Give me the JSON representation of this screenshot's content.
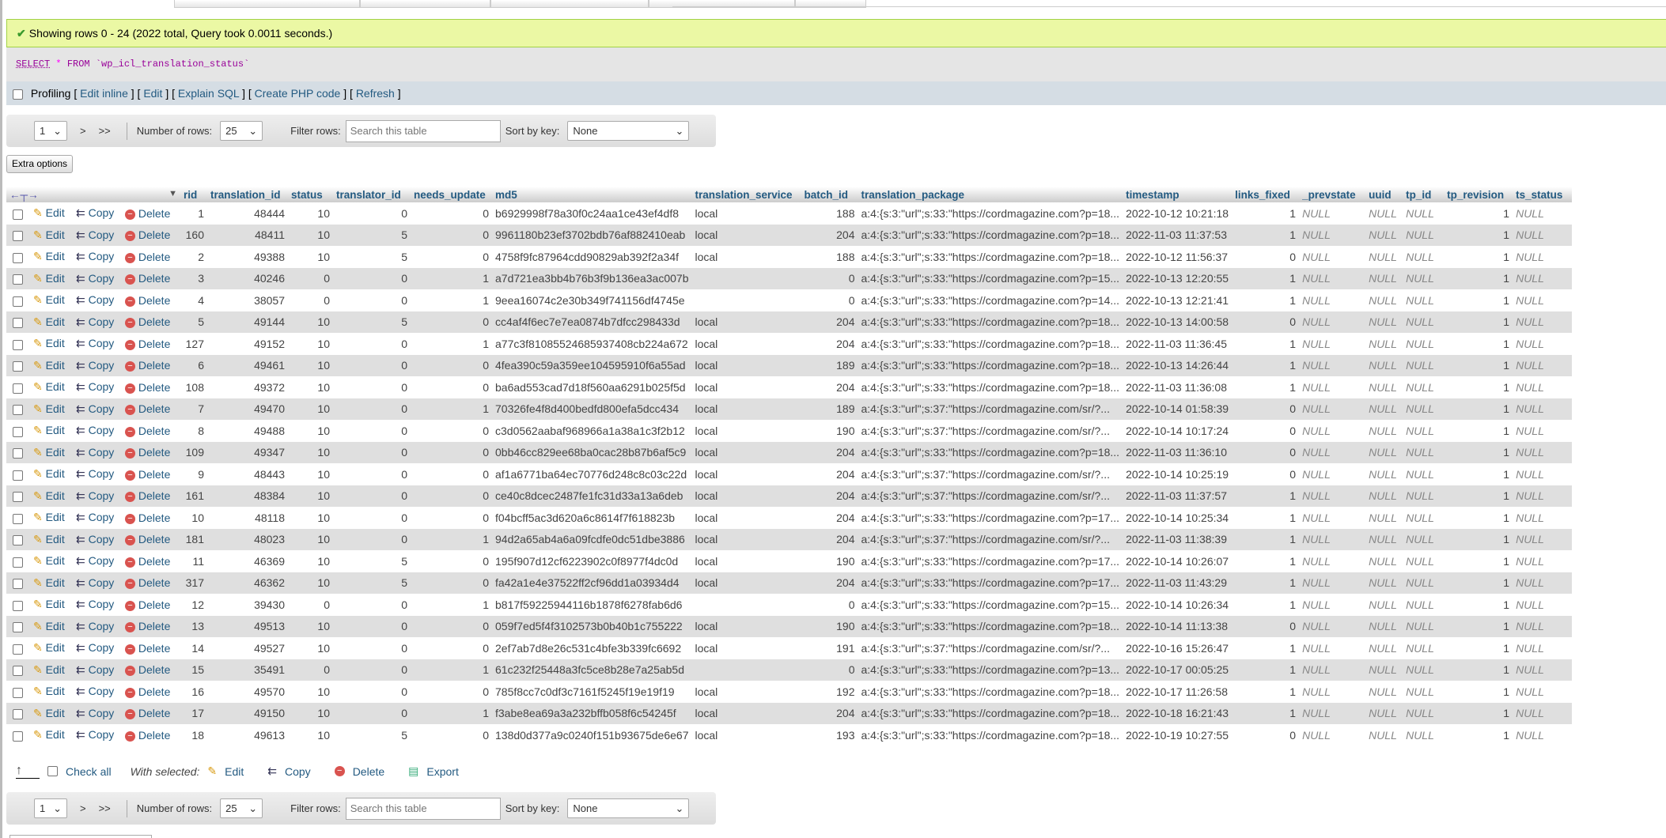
{
  "message": "Showing rows 0 - 24 (2022 total, Query took 0.0011 seconds.)",
  "sql": {
    "keyword": "SELECT",
    "star": "*",
    "from": "FROM",
    "table": "`wp_icl_translation_status`"
  },
  "profiling": {
    "label": "Profiling",
    "links": [
      "Edit inline",
      "Edit",
      "Explain SQL",
      "Create PHP code",
      "Refresh"
    ]
  },
  "nav": {
    "page": "1",
    "next": ">",
    "last": ">>",
    "rows_label": "Number of rows:",
    "rows_value": "25",
    "filter_label": "Filter rows:",
    "filter_placeholder": "Search this table",
    "sort_label": "Sort by key:",
    "sort_value": "None"
  },
  "extra_options": "Extra options",
  "actions": {
    "edit": "Edit",
    "copy": "Copy",
    "delete": "Delete"
  },
  "columns": [
    "rid",
    "translation_id",
    "status",
    "translator_id",
    "needs_update",
    "md5",
    "translation_service",
    "batch_id",
    "translation_package",
    "timestamp",
    "links_fixed",
    "_prevstate",
    "uuid",
    "tp_id",
    "tp_revision",
    "ts_status"
  ],
  "rows": [
    {
      "rid": "1",
      "translation_id": "48444",
      "status": "10",
      "translator_id": "0",
      "needs_update": "0",
      "md5": "b6929998f78a30f0c24aa1ce43ef4df8",
      "translation_service": "local",
      "batch_id": "188",
      "translation_package": "a:4:{s:3:\"url\";s:33:\"https://cordmagazine.com?p=18...",
      "timestamp": "2022-10-12 10:21:18",
      "links_fixed": "1",
      "_prevstate": "NULL",
      "uuid": "NULL",
      "tp_id": "NULL",
      "tp_revision": "1",
      "ts_status": "NULL"
    },
    {
      "rid": "160",
      "translation_id": "48411",
      "status": "10",
      "translator_id": "5",
      "needs_update": "0",
      "md5": "9961180b23ef3702bdb76af882410eab",
      "translation_service": "local",
      "batch_id": "204",
      "translation_package": "a:4:{s:3:\"url\";s:33:\"https://cordmagazine.com?p=18...",
      "timestamp": "2022-11-03 11:37:53",
      "links_fixed": "1",
      "_prevstate": "NULL",
      "uuid": "NULL",
      "tp_id": "NULL",
      "tp_revision": "1",
      "ts_status": "NULL"
    },
    {
      "rid": "2",
      "translation_id": "49388",
      "status": "10",
      "translator_id": "5",
      "needs_update": "0",
      "md5": "4758f9fc87964cdd90829ab392f2a34f",
      "translation_service": "local",
      "batch_id": "188",
      "translation_package": "a:4:{s:3:\"url\";s:33:\"https://cordmagazine.com?p=18...",
      "timestamp": "2022-10-12 11:56:37",
      "links_fixed": "0",
      "_prevstate": "NULL",
      "uuid": "NULL",
      "tp_id": "NULL",
      "tp_revision": "1",
      "ts_status": "NULL"
    },
    {
      "rid": "3",
      "translation_id": "40246",
      "status": "0",
      "translator_id": "0",
      "needs_update": "1",
      "md5": "a7d721ea3bb4b76b3f9b136ea3ac007b",
      "translation_service": "",
      "batch_id": "0",
      "translation_package": "a:4:{s:3:\"url\";s:33:\"https://cordmagazine.com?p=15...",
      "timestamp": "2022-10-13 12:20:55",
      "links_fixed": "1",
      "_prevstate": "NULL",
      "uuid": "NULL",
      "tp_id": "NULL",
      "tp_revision": "1",
      "ts_status": "NULL"
    },
    {
      "rid": "4",
      "translation_id": "38057",
      "status": "0",
      "translator_id": "0",
      "needs_update": "1",
      "md5": "9eea16074c2e30b349f741156df4745e",
      "translation_service": "",
      "batch_id": "0",
      "translation_package": "a:4:{s:3:\"url\";s:33:\"https://cordmagazine.com?p=14...",
      "timestamp": "2022-10-13 12:21:41",
      "links_fixed": "1",
      "_prevstate": "NULL",
      "uuid": "NULL",
      "tp_id": "NULL",
      "tp_revision": "1",
      "ts_status": "NULL"
    },
    {
      "rid": "5",
      "translation_id": "49144",
      "status": "10",
      "translator_id": "5",
      "needs_update": "0",
      "md5": "cc4af4f6ec7e7ea0874b7dfcc298433d",
      "translation_service": "local",
      "batch_id": "204",
      "translation_package": "a:4:{s:3:\"url\";s:33:\"https://cordmagazine.com?p=18...",
      "timestamp": "2022-10-13 14:00:58",
      "links_fixed": "0",
      "_prevstate": "NULL",
      "uuid": "NULL",
      "tp_id": "NULL",
      "tp_revision": "1",
      "ts_status": "NULL"
    },
    {
      "rid": "127",
      "translation_id": "49152",
      "status": "10",
      "translator_id": "0",
      "needs_update": "1",
      "md5": "a77c3f81085524685937408cb224a672",
      "translation_service": "local",
      "batch_id": "204",
      "translation_package": "a:4:{s:3:\"url\";s:33:\"https://cordmagazine.com?p=18...",
      "timestamp": "2022-11-03 11:36:45",
      "links_fixed": "1",
      "_prevstate": "NULL",
      "uuid": "NULL",
      "tp_id": "NULL",
      "tp_revision": "1",
      "ts_status": "NULL"
    },
    {
      "rid": "6",
      "translation_id": "49461",
      "status": "10",
      "translator_id": "0",
      "needs_update": "0",
      "md5": "4fea390c59a359ee104595910f6a55ad",
      "translation_service": "local",
      "batch_id": "189",
      "translation_package": "a:4:{s:3:\"url\";s:33:\"https://cordmagazine.com?p=18...",
      "timestamp": "2022-10-13 14:26:44",
      "links_fixed": "1",
      "_prevstate": "NULL",
      "uuid": "NULL",
      "tp_id": "NULL",
      "tp_revision": "1",
      "ts_status": "NULL"
    },
    {
      "rid": "108",
      "translation_id": "49372",
      "status": "10",
      "translator_id": "0",
      "needs_update": "0",
      "md5": "ba6ad553cad7d18f560aa6291b025f5d",
      "translation_service": "local",
      "batch_id": "204",
      "translation_package": "a:4:{s:3:\"url\";s:33:\"https://cordmagazine.com?p=18...",
      "timestamp": "2022-11-03 11:36:08",
      "links_fixed": "1",
      "_prevstate": "NULL",
      "uuid": "NULL",
      "tp_id": "NULL",
      "tp_revision": "1",
      "ts_status": "NULL"
    },
    {
      "rid": "7",
      "translation_id": "49470",
      "status": "10",
      "translator_id": "0",
      "needs_update": "1",
      "md5": "70326fe4f8d400bedfd800efa5dcc434",
      "translation_service": "local",
      "batch_id": "189",
      "translation_package": "a:4:{s:3:\"url\";s:37:\"https://cordmagazine.com/sr/?...",
      "timestamp": "2022-10-14 01:58:39",
      "links_fixed": "0",
      "_prevstate": "NULL",
      "uuid": "NULL",
      "tp_id": "NULL",
      "tp_revision": "1",
      "ts_status": "NULL"
    },
    {
      "rid": "8",
      "translation_id": "49488",
      "status": "10",
      "translator_id": "0",
      "needs_update": "0",
      "md5": "c3d0562aabaf968966a1a38a1c3f2b12",
      "translation_service": "local",
      "batch_id": "190",
      "translation_package": "a:4:{s:3:\"url\";s:37:\"https://cordmagazine.com/sr/?...",
      "timestamp": "2022-10-14 10:17:24",
      "links_fixed": "0",
      "_prevstate": "NULL",
      "uuid": "NULL",
      "tp_id": "NULL",
      "tp_revision": "1",
      "ts_status": "NULL"
    },
    {
      "rid": "109",
      "translation_id": "49347",
      "status": "10",
      "translator_id": "0",
      "needs_update": "0",
      "md5": "0bb46cc829ee68ba0cac28b87b6af5c9",
      "translation_service": "local",
      "batch_id": "204",
      "translation_package": "a:4:{s:3:\"url\";s:33:\"https://cordmagazine.com?p=18...",
      "timestamp": "2022-11-03 11:36:10",
      "links_fixed": "0",
      "_prevstate": "NULL",
      "uuid": "NULL",
      "tp_id": "NULL",
      "tp_revision": "1",
      "ts_status": "NULL"
    },
    {
      "rid": "9",
      "translation_id": "48443",
      "status": "10",
      "translator_id": "0",
      "needs_update": "0",
      "md5": "af1a6771ba64ec70776d248c8c03c22d",
      "translation_service": "local",
      "batch_id": "204",
      "translation_package": "a:4:{s:3:\"url\";s:37:\"https://cordmagazine.com/sr/?...",
      "timestamp": "2022-10-14 10:25:19",
      "links_fixed": "0",
      "_prevstate": "NULL",
      "uuid": "NULL",
      "tp_id": "NULL",
      "tp_revision": "1",
      "ts_status": "NULL"
    },
    {
      "rid": "161",
      "translation_id": "48384",
      "status": "10",
      "translator_id": "0",
      "needs_update": "0",
      "md5": "ce40c8dcec2487fe1fc31d33a13a6deb",
      "translation_service": "local",
      "batch_id": "204",
      "translation_package": "a:4:{s:3:\"url\";s:37:\"https://cordmagazine.com/sr/?...",
      "timestamp": "2022-11-03 11:37:57",
      "links_fixed": "1",
      "_prevstate": "NULL",
      "uuid": "NULL",
      "tp_id": "NULL",
      "tp_revision": "1",
      "ts_status": "NULL"
    },
    {
      "rid": "10",
      "translation_id": "48118",
      "status": "10",
      "translator_id": "0",
      "needs_update": "0",
      "md5": "f04bcff5ac3d620a6c8614f7f618823b",
      "translation_service": "local",
      "batch_id": "204",
      "translation_package": "a:4:{s:3:\"url\";s:33:\"https://cordmagazine.com?p=17...",
      "timestamp": "2022-10-14 10:25:34",
      "links_fixed": "1",
      "_prevstate": "NULL",
      "uuid": "NULL",
      "tp_id": "NULL",
      "tp_revision": "1",
      "ts_status": "NULL"
    },
    {
      "rid": "181",
      "translation_id": "48023",
      "status": "10",
      "translator_id": "0",
      "needs_update": "1",
      "md5": "94d2a65ab4a6a09fcdfe0dc51dbe3886",
      "translation_service": "local",
      "batch_id": "204",
      "translation_package": "a:4:{s:3:\"url\";s:37:\"https://cordmagazine.com/sr/?...",
      "timestamp": "2022-11-03 11:38:39",
      "links_fixed": "1",
      "_prevstate": "NULL",
      "uuid": "NULL",
      "tp_id": "NULL",
      "tp_revision": "1",
      "ts_status": "NULL"
    },
    {
      "rid": "11",
      "translation_id": "46369",
      "status": "10",
      "translator_id": "5",
      "needs_update": "0",
      "md5": "195f907d12cf6223902c0f8977f4dc0d",
      "translation_service": "local",
      "batch_id": "190",
      "translation_package": "a:4:{s:3:\"url\";s:33:\"https://cordmagazine.com?p=17...",
      "timestamp": "2022-10-14 10:26:07",
      "links_fixed": "1",
      "_prevstate": "NULL",
      "uuid": "NULL",
      "tp_id": "NULL",
      "tp_revision": "1",
      "ts_status": "NULL"
    },
    {
      "rid": "317",
      "translation_id": "46362",
      "status": "10",
      "translator_id": "5",
      "needs_update": "0",
      "md5": "fa42a1e4e37522ff2cf96dd1a03934d4",
      "translation_service": "local",
      "batch_id": "204",
      "translation_package": "a:4:{s:3:\"url\";s:33:\"https://cordmagazine.com?p=17...",
      "timestamp": "2022-11-03 11:43:29",
      "links_fixed": "1",
      "_prevstate": "NULL",
      "uuid": "NULL",
      "tp_id": "NULL",
      "tp_revision": "1",
      "ts_status": "NULL"
    },
    {
      "rid": "12",
      "translation_id": "39430",
      "status": "0",
      "translator_id": "0",
      "needs_update": "1",
      "md5": "b817f59225944116b1878f6278fab6d6",
      "translation_service": "",
      "batch_id": "0",
      "translation_package": "a:4:{s:3:\"url\";s:33:\"https://cordmagazine.com?p=15...",
      "timestamp": "2022-10-14 10:26:34",
      "links_fixed": "1",
      "_prevstate": "NULL",
      "uuid": "NULL",
      "tp_id": "NULL",
      "tp_revision": "1",
      "ts_status": "NULL"
    },
    {
      "rid": "13",
      "translation_id": "49513",
      "status": "10",
      "translator_id": "0",
      "needs_update": "0",
      "md5": "059f7ed5f4f3102573b0b40b1c755222",
      "translation_service": "local",
      "batch_id": "190",
      "translation_package": "a:4:{s:3:\"url\";s:33:\"https://cordmagazine.com?p=18...",
      "timestamp": "2022-10-14 11:13:38",
      "links_fixed": "0",
      "_prevstate": "NULL",
      "uuid": "NULL",
      "tp_id": "NULL",
      "tp_revision": "1",
      "ts_status": "NULL"
    },
    {
      "rid": "14",
      "translation_id": "49527",
      "status": "10",
      "translator_id": "0",
      "needs_update": "0",
      "md5": "2ef7ab7d8e26c531c4bfe3b339fc6692",
      "translation_service": "local",
      "batch_id": "191",
      "translation_package": "a:4:{s:3:\"url\";s:37:\"https://cordmagazine.com/sr/?...",
      "timestamp": "2022-10-16 15:26:47",
      "links_fixed": "1",
      "_prevstate": "NULL",
      "uuid": "NULL",
      "tp_id": "NULL",
      "tp_revision": "1",
      "ts_status": "NULL"
    },
    {
      "rid": "15",
      "translation_id": "35491",
      "status": "0",
      "translator_id": "0",
      "needs_update": "1",
      "md5": "61c232f25448a3fc5ce8b28e7a25ab5d",
      "translation_service": "",
      "batch_id": "0",
      "translation_package": "a:4:{s:3:\"url\";s:33:\"https://cordmagazine.com?p=13...",
      "timestamp": "2022-10-17 00:05:25",
      "links_fixed": "1",
      "_prevstate": "NULL",
      "uuid": "NULL",
      "tp_id": "NULL",
      "tp_revision": "1",
      "ts_status": "NULL"
    },
    {
      "rid": "16",
      "translation_id": "49570",
      "status": "10",
      "translator_id": "0",
      "needs_update": "0",
      "md5": "785f8cc7c0df3c7161f5245f19e19f19",
      "translation_service": "local",
      "batch_id": "192",
      "translation_package": "a:4:{s:3:\"url\";s:33:\"https://cordmagazine.com?p=18...",
      "timestamp": "2022-10-17 11:26:58",
      "links_fixed": "1",
      "_prevstate": "NULL",
      "uuid": "NULL",
      "tp_id": "NULL",
      "tp_revision": "1",
      "ts_status": "NULL"
    },
    {
      "rid": "17",
      "translation_id": "49150",
      "status": "10",
      "translator_id": "0",
      "needs_update": "1",
      "md5": "f3abe8ea69a3a232bffb058f6c54245f",
      "translation_service": "local",
      "batch_id": "204",
      "translation_package": "a:4:{s:3:\"url\";s:33:\"https://cordmagazine.com?p=18...",
      "timestamp": "2022-10-18 16:21:43",
      "links_fixed": "1",
      "_prevstate": "NULL",
      "uuid": "NULL",
      "tp_id": "NULL",
      "tp_revision": "1",
      "ts_status": "NULL"
    },
    {
      "rid": "18",
      "translation_id": "49613",
      "status": "10",
      "translator_id": "5",
      "needs_update": "0",
      "md5": "138d0d377a9c0240f151b93675de6e67",
      "translation_service": "local",
      "batch_id": "193",
      "translation_package": "a:4:{s:3:\"url\";s:33:\"https://cordmagazine.com?p=18...",
      "timestamp": "2022-10-19 10:27:55",
      "links_fixed": "0",
      "_prevstate": "NULL",
      "uuid": "NULL",
      "tp_id": "NULL",
      "tp_revision": "1",
      "ts_status": "NULL"
    }
  ],
  "footer": {
    "check_all": "Check all",
    "with_selected": "With selected:",
    "edit": "Edit",
    "copy": "Copy",
    "delete": "Delete",
    "export": "Export"
  }
}
